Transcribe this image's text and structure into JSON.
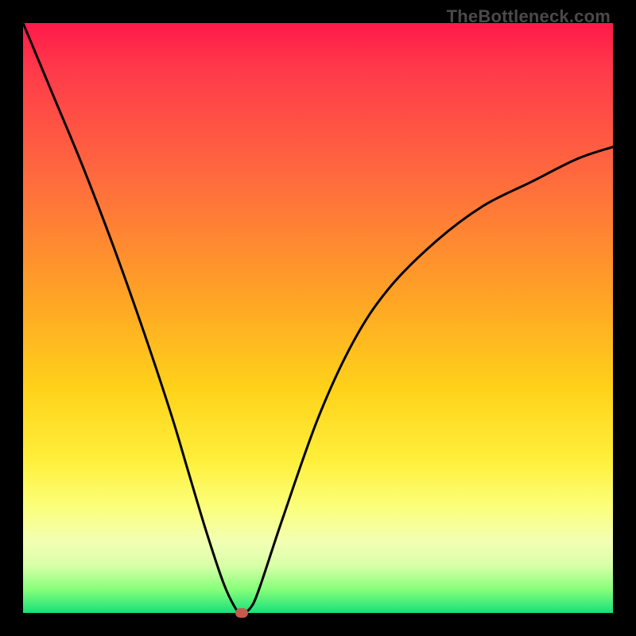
{
  "watermark": "TheBottleneck.com",
  "chart_data": {
    "type": "line",
    "title": "",
    "xlabel": "",
    "ylabel": "",
    "xlim": [
      0,
      100
    ],
    "ylim": [
      0,
      100
    ],
    "series": [
      {
        "name": "bottleneck-curve",
        "x": [
          0,
          5,
          10,
          15,
          20,
          25,
          28,
          31,
          34,
          36,
          37,
          38.5,
          40,
          44,
          50,
          56,
          62,
          70,
          78,
          86,
          94,
          100
        ],
        "y": [
          100,
          88,
          76,
          63,
          49,
          34,
          24,
          14,
          5,
          0.8,
          0,
          0.8,
          4,
          16,
          33,
          46,
          55,
          63,
          69,
          73,
          77,
          79
        ]
      }
    ],
    "annotations": [
      {
        "name": "optimal-point",
        "x": 37,
        "y": 0
      }
    ],
    "background_gradient": {
      "stops": [
        {
          "pos": 0.0,
          "color": "#ff1a4a"
        },
        {
          "pos": 0.46,
          "color": "#ffa226"
        },
        {
          "pos": 0.74,
          "color": "#ffef3a"
        },
        {
          "pos": 0.92,
          "color": "#d8ffa8"
        },
        {
          "pos": 1.0,
          "color": "#17e07a"
        }
      ]
    }
  }
}
